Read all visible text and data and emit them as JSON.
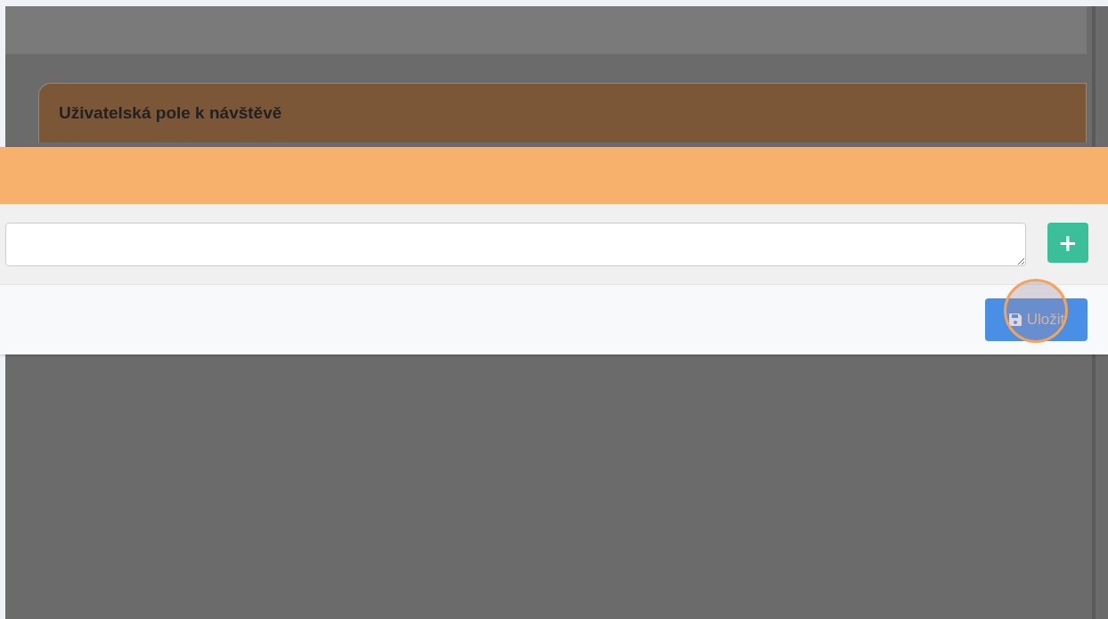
{
  "card": {
    "title": "Uživatelská pole k návštěvě"
  },
  "modal": {
    "add_button": {
      "label": "+"
    },
    "save_button": {
      "label": "Uložit"
    }
  }
}
